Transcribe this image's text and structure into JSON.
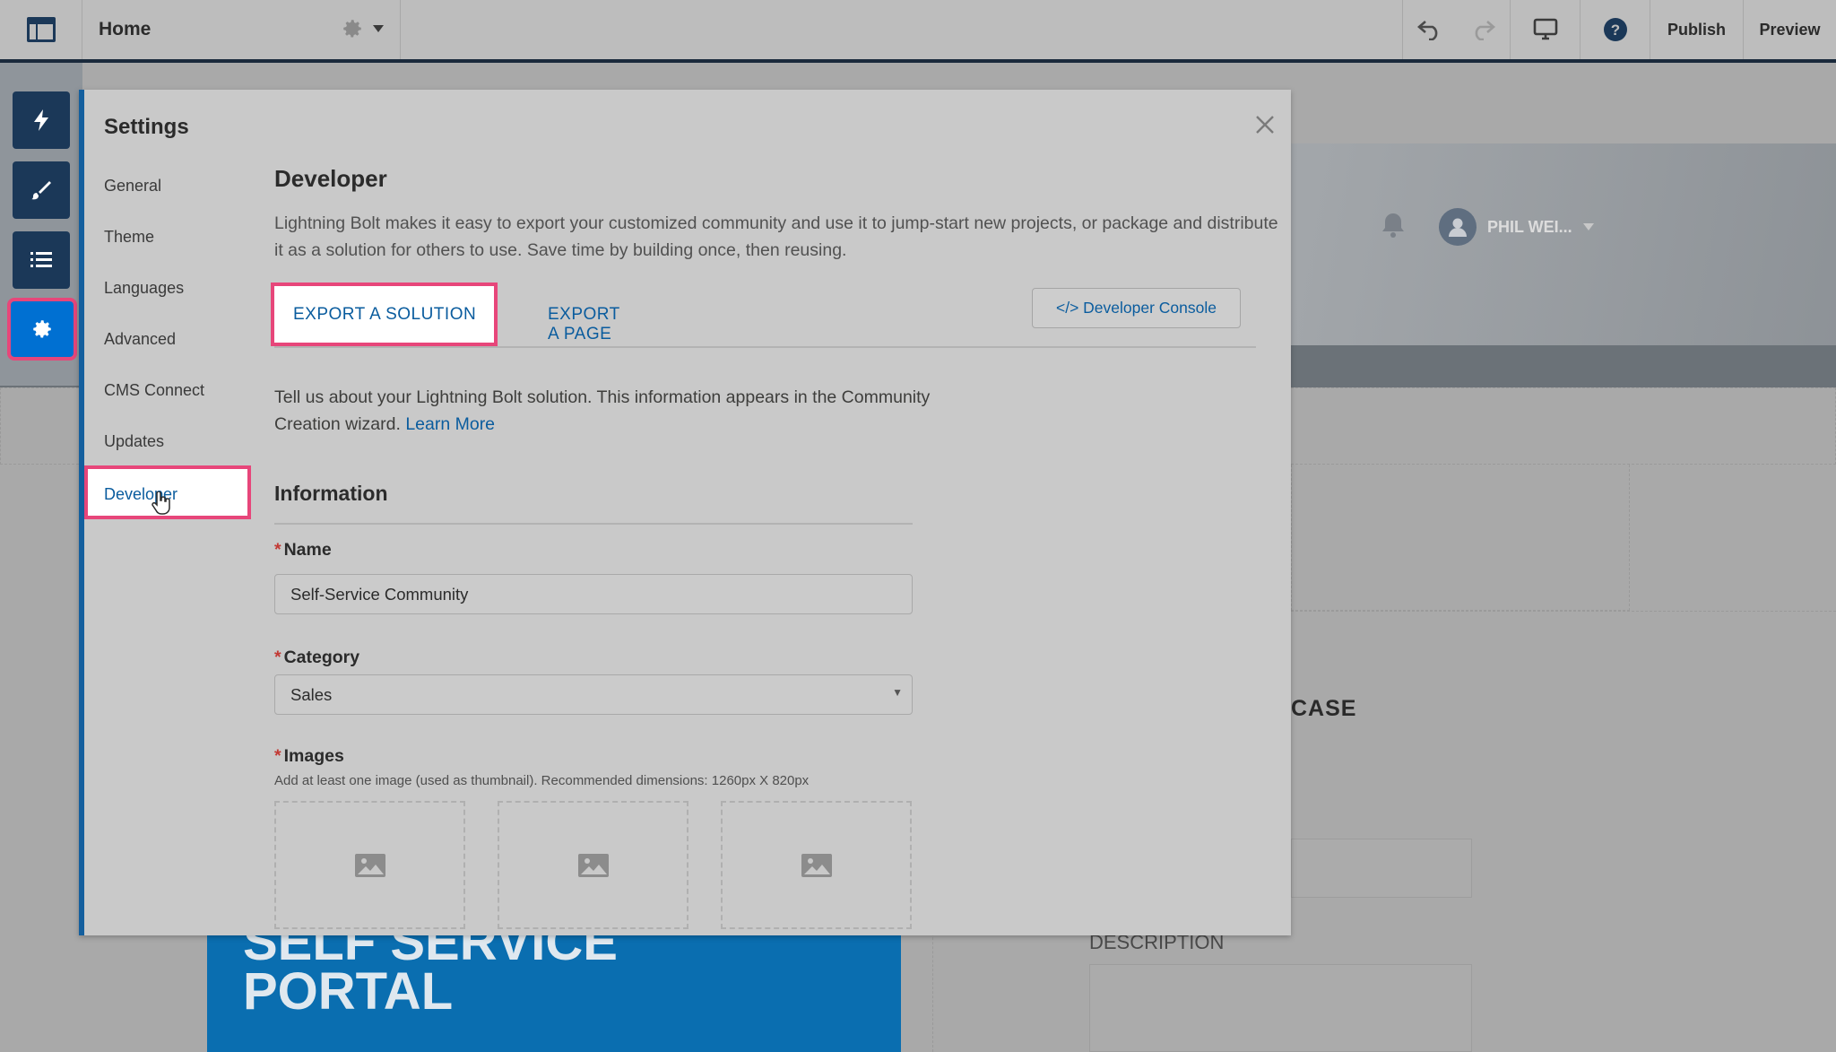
{
  "topbar": {
    "page_title": "Home",
    "publish_label": "Publish",
    "preview_label": "Preview"
  },
  "background": {
    "user_name": "PHIL WEI...",
    "case_label": "CASE",
    "description_label": "DESCRIPTION",
    "portal_line1": "SELF SERVICE",
    "portal_line2": "PORTAL"
  },
  "settings": {
    "title": "Settings",
    "nav": [
      "General",
      "Theme",
      "Languages",
      "Advanced",
      "CMS Connect",
      "Updates",
      "Developer"
    ],
    "active_nav": "Developer"
  },
  "developer": {
    "heading": "Developer",
    "description": "Lightning Bolt makes it easy to export your customized community and use it to jump-start new projects, or package and distribute it as a solution for others to use. Save time by building once, then reusing.",
    "tab_export_solution": "EXPORT A SOLUTION",
    "tab_export_page": "EXPORT A PAGE",
    "developer_console_label": "</> Developer Console",
    "intro_text": "Tell us about your Lightning Bolt solution. This information appears in the Community Creation wizard.",
    "learn_more": "Learn More",
    "information_heading": "Information",
    "name_label": "Name",
    "name_value": "Self-Service Community",
    "category_label": "Category",
    "category_value": "Sales",
    "images_label": "Images",
    "images_hint": "Add at least one image (used as thumbnail). Recommended dimensions: 1260px X 820px"
  },
  "colors": {
    "accent_blue": "#0070d2",
    "highlight_pink": "#e7467a",
    "link_blue": "#0a5c9e",
    "required_red": "#c23934"
  }
}
